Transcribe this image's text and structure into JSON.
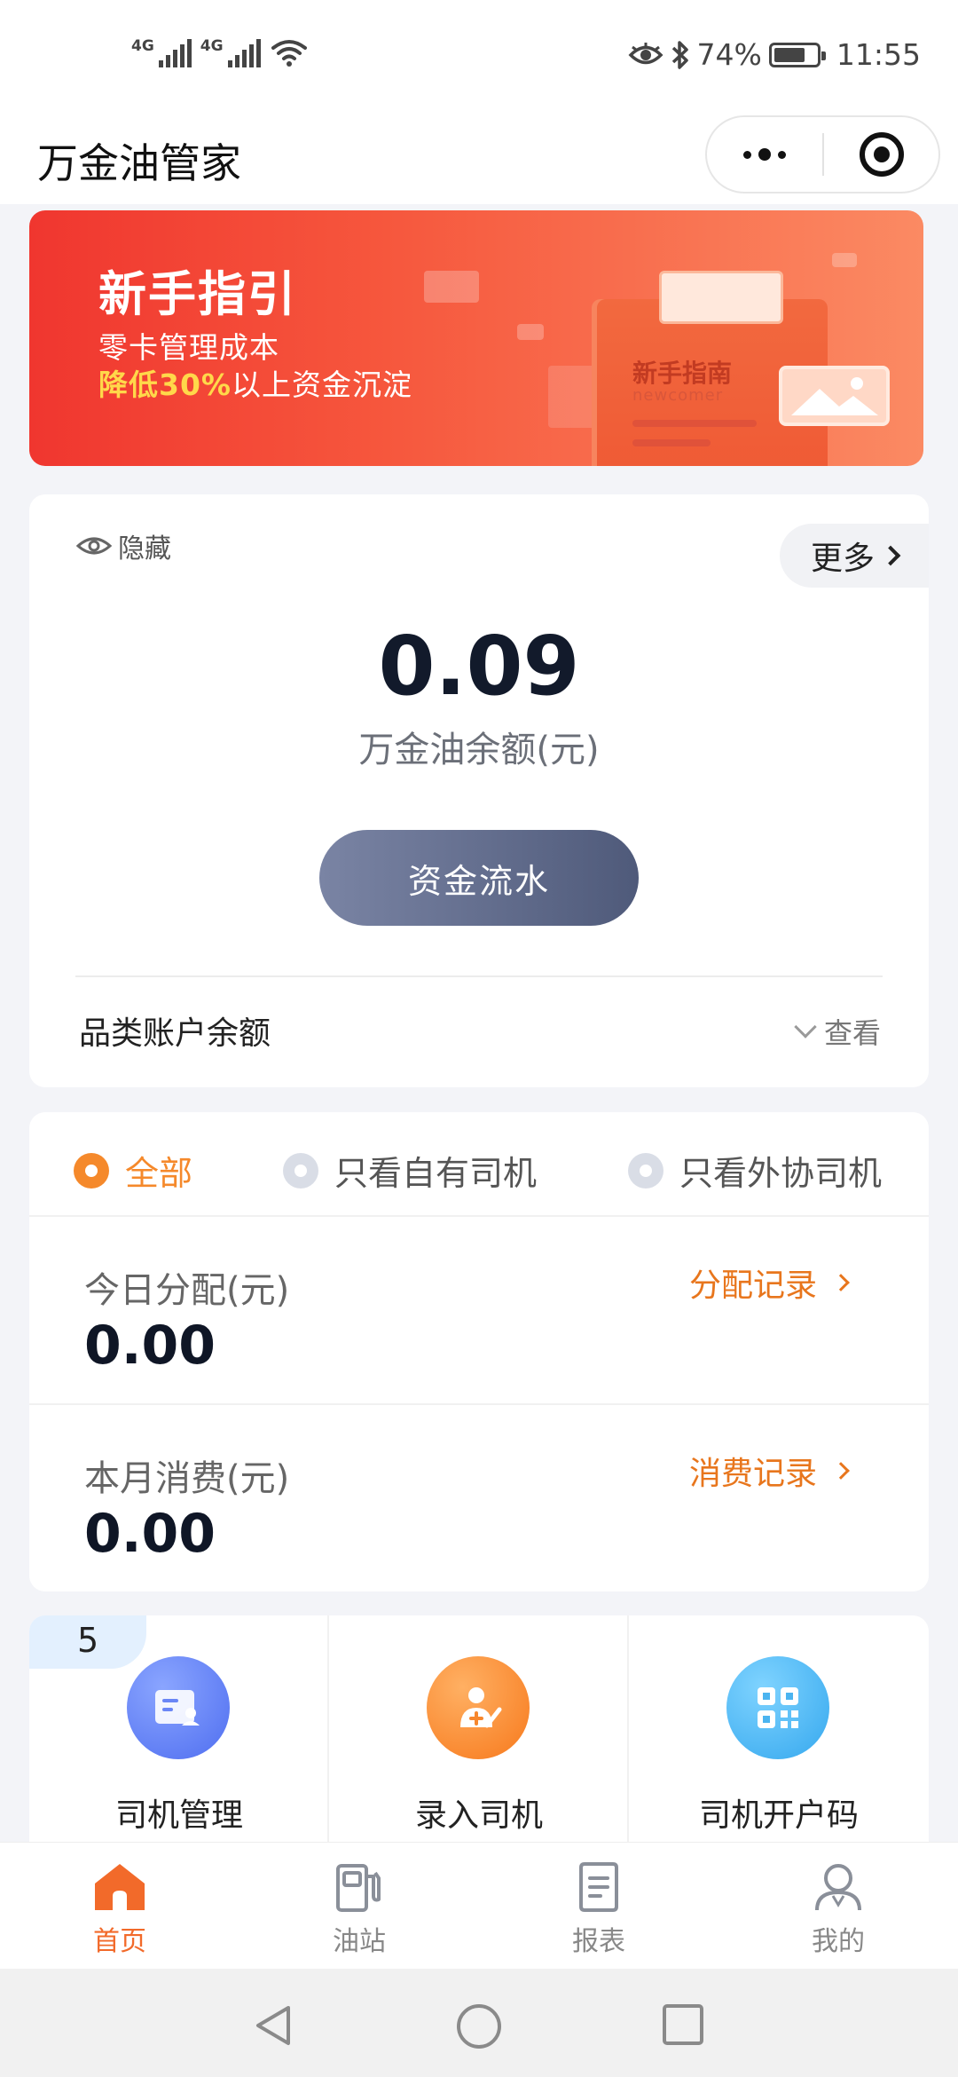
{
  "status_bar": {
    "signal1": "4G",
    "signal2": "4G",
    "battery_percent": "74%",
    "battery_level": 0.74,
    "time": "11:55"
  },
  "header": {
    "title": "万金油管家"
  },
  "banner": {
    "title": "新手指引",
    "line1": "零卡管理成本",
    "line2_highlight": "降低30%",
    "line2_rest": "以上资金沉淀",
    "book_title": "新手指南",
    "book_sub": "newcomer"
  },
  "balance": {
    "hide_label": "隐藏",
    "more_label": "更多",
    "value": "0.09",
    "label": "万金油余额(元)",
    "flow_button": "资金流水",
    "category_label": "品类账户余额",
    "view_label": "查看"
  },
  "filters": {
    "options": [
      "全部",
      "只看自有司机",
      "只看外协司机"
    ],
    "selected": "全部"
  },
  "stats": {
    "today_label": "今日分配(元)",
    "today_value": "0.00",
    "today_link": "分配记录",
    "month_label": "本月消费(元)",
    "month_value": "0.00",
    "month_link": "消费记录"
  },
  "menu": {
    "badge": "5",
    "items": [
      {
        "label": "司机管理",
        "icon": "driver-card-icon"
      },
      {
        "label": "录入司机",
        "icon": "add-driver-icon"
      },
      {
        "label": "司机开户码",
        "icon": "qr-code-icon"
      }
    ]
  },
  "tabs": {
    "items": [
      {
        "label": "首页",
        "icon": "home-icon"
      },
      {
        "label": "油站",
        "icon": "gas-station-icon"
      },
      {
        "label": "报表",
        "icon": "report-icon"
      },
      {
        "label": "我的",
        "icon": "profile-icon"
      }
    ],
    "active": "首页"
  },
  "colors": {
    "accent": "#f5892b",
    "banner_start": "#f0362f",
    "banner_end": "#fb8a63",
    "button_start": "#7a84a4",
    "button_end": "#4f5a7a",
    "link": "#e8761d",
    "tab_active": "#f26a2a"
  }
}
